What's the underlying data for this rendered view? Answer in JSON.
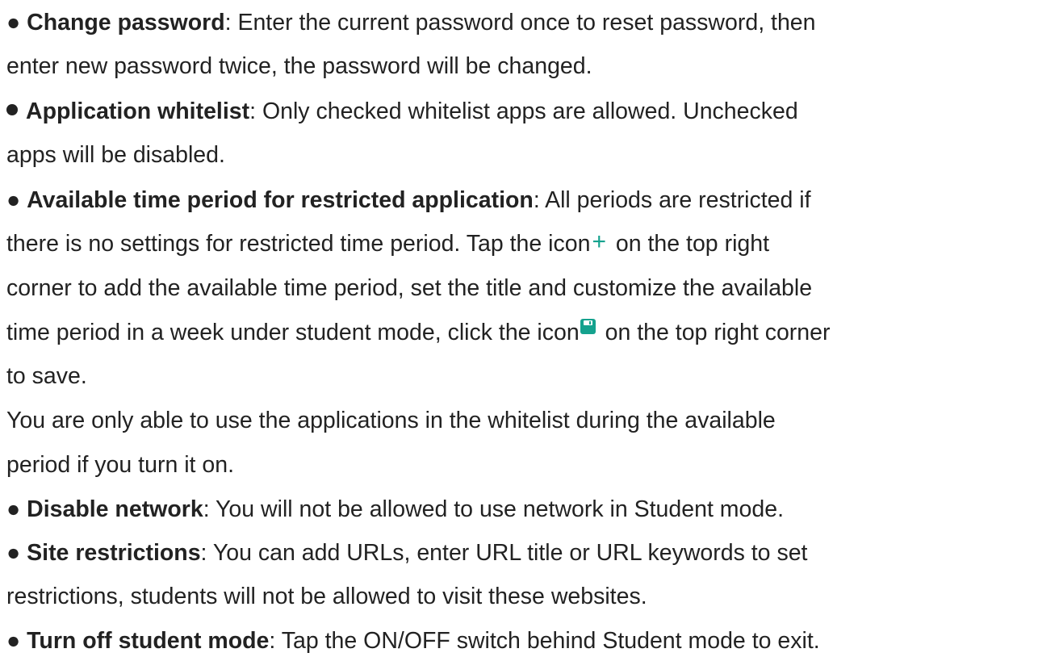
{
  "items": [
    {
      "term": "Change password",
      "line1": ": Enter the current password once to reset password, then",
      "line2": "enter new password twice, the password will be changed."
    },
    {
      "term": "Application whitelist",
      "line1": ": Only checked whitelist apps are allowed. Unchecked",
      "line2": "apps will be disabled."
    },
    {
      "term": "Available time period for restricted application",
      "line1": ": All periods are restricted if",
      "line2_a": "there is no settings for restricted time period. Tap the icon",
      "line2_icon": "+",
      "line2_b": " on the top right",
      "line3": "corner to add the available time period, set the title and customize the available",
      "line4_a": "time period in a week under student mode, click the icon",
      "line4_b": " on the top right corner",
      "line5": "to save."
    },
    {
      "line1": "You are only able to use the applications in the whitelist during the available",
      "line2": "period if you turn it on."
    },
    {
      "term": "Disable network",
      "line1": ": You will not be allowed to use network in Student mode."
    },
    {
      "term": "Site restrictions",
      "line1": ": You can add URLs, enter URL title or URL keywords to set",
      "line2": "restrictions, students will not be allowed to visit these websites."
    },
    {
      "term": "Turn off student mode",
      "line1": ": Tap the ON/OFF switch behind Student mode to exit."
    }
  ],
  "icons": {
    "plus": "plus-icon",
    "save": "save-icon",
    "accent_color": "#15a28e"
  }
}
